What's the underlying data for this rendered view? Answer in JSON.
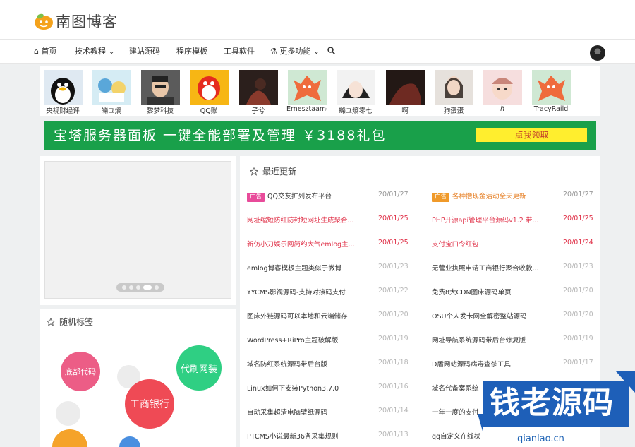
{
  "site": {
    "name": "南图博客"
  },
  "nav": {
    "home": "首页",
    "tech": "技术教程",
    "source": "建站源码",
    "templates": "程序模板",
    "tools": "工具软件",
    "more": "更多功能"
  },
  "friends": [
    {
      "name": "央视财经评"
    },
    {
      "name": "皪ユ熵"
    },
    {
      "name": "黎梦科技"
    },
    {
      "name": "QQ账"
    },
    {
      "name": "子兮"
    },
    {
      "name": "Ernesztaamomo"
    },
    {
      "name": "皪ユ熵零七"
    },
    {
      "name": "啊"
    },
    {
      "name": "狗蛋蛋"
    },
    {
      "name": "ℏ"
    },
    {
      "name": "TracyRaild"
    }
  ],
  "banner": {
    "text": "宝塔服务器面板 一键全能部署及管理 ￥3188礼包",
    "button": "点我领取"
  },
  "tags": {
    "title": "随机标签",
    "items": [
      "底部代码",
      "代刷网装",
      "工商银行"
    ]
  },
  "news": {
    "title": "最近更新",
    "badge": "广告",
    "left": [
      {
        "title": "QQ交友扩列发布平台",
        "date": "20/01/27",
        "ad": true
      },
      {
        "title": "网址缩短防红防封短网址生成聚合...",
        "date": "20/01/25",
        "hot": true
      },
      {
        "title": "新仿小刀娱乐网简约大气emlog主...",
        "date": "20/01/25",
        "hot": true
      },
      {
        "title": "emlog博客模板主题类似于微博",
        "date": "20/01/23"
      },
      {
        "title": "YYCMS影视源码-支持对接码支付",
        "date": "20/01/22"
      },
      {
        "title": "图床外链源码可以本地和云端储存",
        "date": "20/01/20"
      },
      {
        "title": "WordPress+RiPro主题破解版",
        "date": "20/01/19"
      },
      {
        "title": "域名防红系统源码带后台版",
        "date": "20/01/18"
      },
      {
        "title": "Linux如何下安装Python3.7.0",
        "date": "20/01/16"
      },
      {
        "title": "自动采集超清电脑壁纸源码",
        "date": "20/01/14"
      },
      {
        "title": "PTCMS小说最新36条采集规则",
        "date": "20/01/13"
      }
    ],
    "right": [
      {
        "title": "各种撸现金活动全天更新",
        "date": "20/01/27",
        "ad": true
      },
      {
        "title": "PHP开源api管理平台源码v1.2 带...",
        "date": "20/01/25",
        "hot": true
      },
      {
        "title": "支付宝口令红包",
        "date": "20/01/24",
        "hot": true
      },
      {
        "title": "无营业执照申请工商银行聚合收款...",
        "date": "20/01/23"
      },
      {
        "title": "免费8大CDN图床源码单页",
        "date": "20/01/20"
      },
      {
        "title": "OSU个人发卡网全解密整站源码",
        "date": "20/01/20"
      },
      {
        "title": "网址导航系统源码带后台修复版",
        "date": "20/01/19"
      },
      {
        "title": "D盾网站源码病毒查杀工具",
        "date": "20/01/17"
      },
      {
        "title": "域名代备案系统",
        "date": ""
      },
      {
        "title": "一年一度的支付",
        "date": ""
      },
      {
        "title": "qq自定义在线状",
        "date": ""
      }
    ]
  },
  "watermark": {
    "text": "钱老源码",
    "url": "qianlao.cn"
  },
  "colors": {
    "accent": "#19a04a",
    "hot": "#e0334a",
    "ad": "#e84b9a",
    "ad2": "#f09a2a"
  }
}
